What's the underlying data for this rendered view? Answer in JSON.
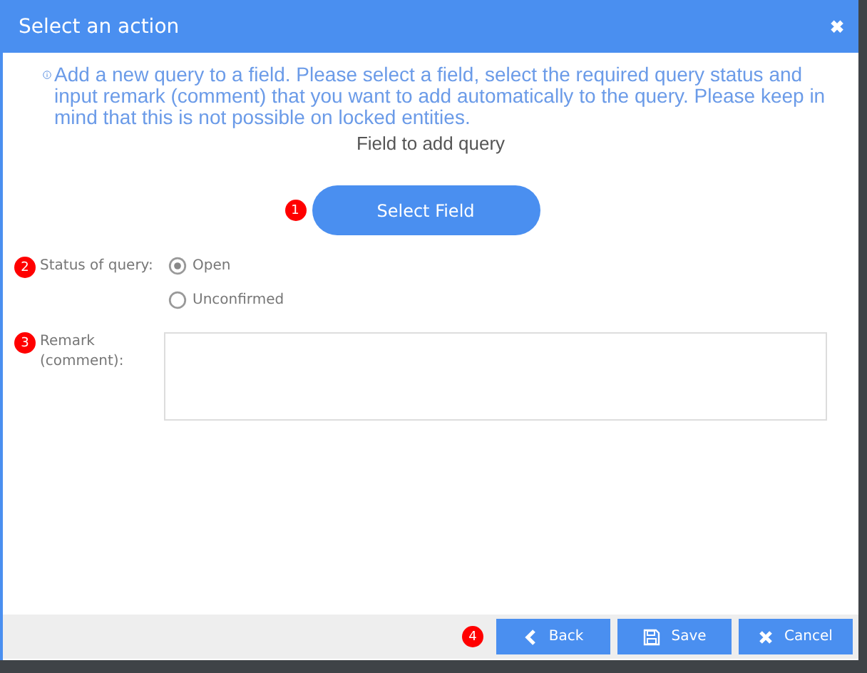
{
  "window": {
    "title": "Select an action",
    "close": "✖"
  },
  "info": "Add a new query to a field. Please select a field, select the required query status and input remark (comment) that you want to add automatically to the query. Please keep in mind that this is not possible on locked entities.",
  "field_heading": "Field to add query",
  "select_field": {
    "marker": "1",
    "label": "Select Field"
  },
  "status": {
    "marker": "2",
    "label": "Status of query:",
    "options": [
      {
        "label": "Open",
        "selected": true
      },
      {
        "label": "Unconfirmed",
        "selected": false
      }
    ]
  },
  "remark": {
    "marker": "3",
    "label": "Remark (comment):"
  },
  "footer": {
    "marker": "4",
    "buttons": [
      {
        "kind": "back",
        "label": "Back"
      },
      {
        "kind": "save",
        "label": "Save"
      },
      {
        "kind": "cancel",
        "label": "Cancel"
      }
    ]
  }
}
